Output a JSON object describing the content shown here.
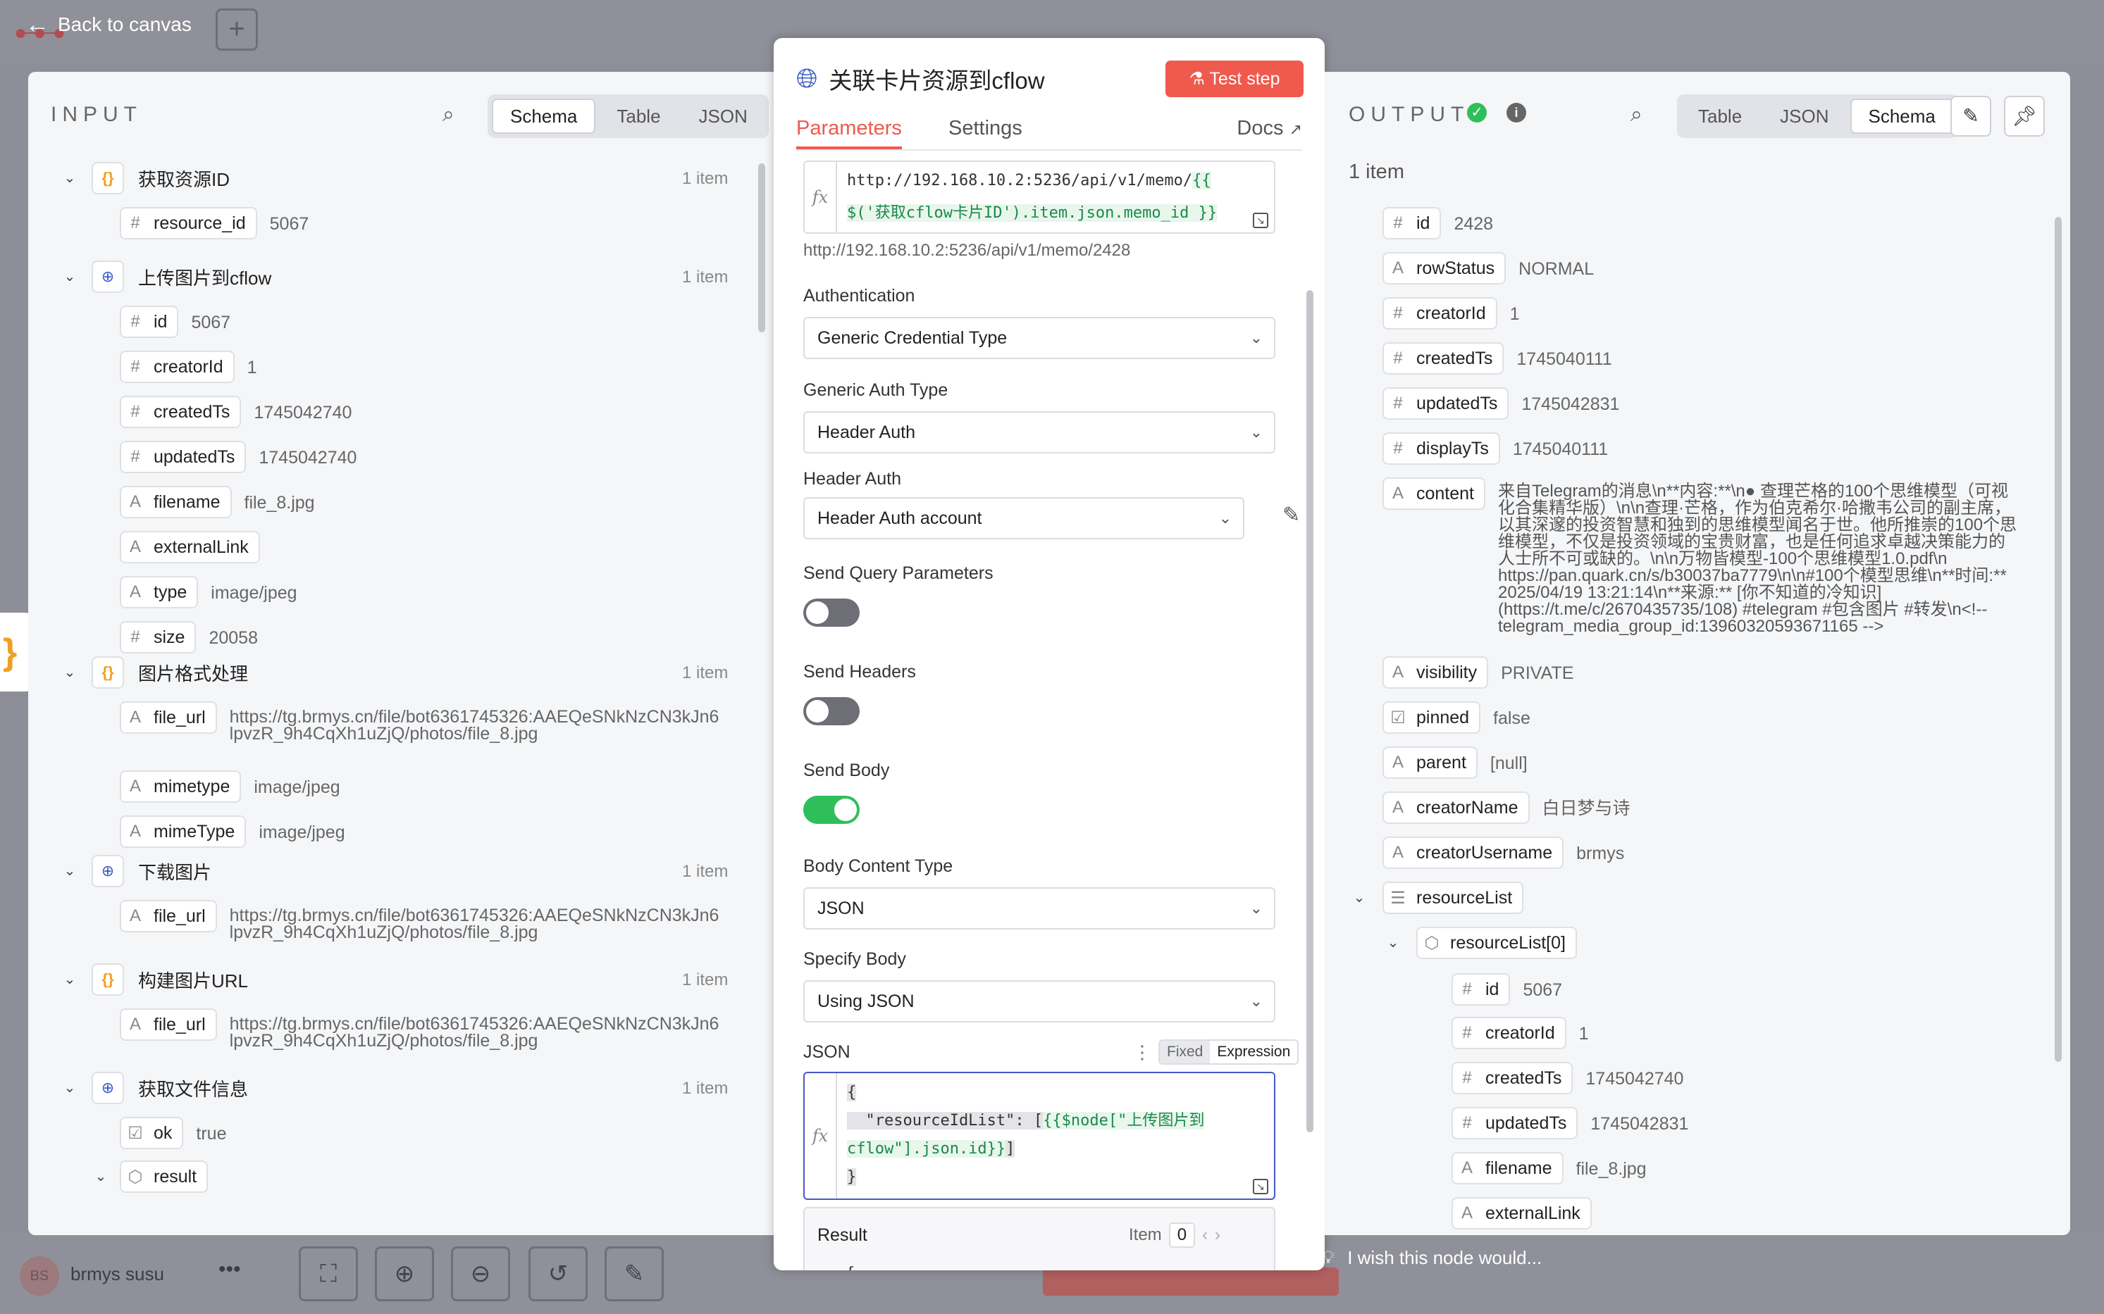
{
  "topbar": {
    "back_label": "Back to canvas",
    "plus_label": "+"
  },
  "bottombar": {
    "user_initials": "BS",
    "user_name": "brmys susu",
    "more_label": "•••",
    "idea_text": "I wish this node would..."
  },
  "input": {
    "title": "INPUT",
    "tabs": [
      "Schema",
      "Table",
      "JSON"
    ],
    "active_tab": "Schema",
    "nodes": [
      {
        "name": "获取资源ID",
        "icon": "brace",
        "count": "1 item",
        "fields": [
          {
            "type": "#",
            "key": "resource_id",
            "value": "5067"
          }
        ]
      },
      {
        "name": "上传图片到cflow",
        "icon": "globe",
        "count": "1 item",
        "fields": [
          {
            "type": "#",
            "key": "id",
            "value": "5067"
          },
          {
            "type": "#",
            "key": "creatorId",
            "value": "1"
          },
          {
            "type": "#",
            "key": "createdTs",
            "value": "1745042740"
          },
          {
            "type": "#",
            "key": "updatedTs",
            "value": "1745042740"
          },
          {
            "type": "A",
            "key": "filename",
            "value": "file_8.jpg"
          },
          {
            "type": "A",
            "key": "externalLink",
            "value": ""
          },
          {
            "type": "A",
            "key": "type",
            "value": "image/jpeg"
          },
          {
            "type": "#",
            "key": "size",
            "value": "20058"
          }
        ]
      },
      {
        "name": "图片格式处理",
        "icon": "brace",
        "count": "1 item",
        "fields": [
          {
            "type": "A",
            "key": "file_url",
            "value": "https://tg.brmys.cn/file/bot6361745326:AAEQeSNkNzCN3kJn6lpvzR_9h4CqXh1uZjQ/photos/file_8.jpg"
          },
          {
            "type": "A",
            "key": "mimetype",
            "value": "image/jpeg"
          },
          {
            "type": "A",
            "key": "mimeType",
            "value": "image/jpeg"
          }
        ]
      },
      {
        "name": "下载图片",
        "icon": "globe",
        "count": "1 item",
        "fields": [
          {
            "type": "A",
            "key": "file_url",
            "value": "https://tg.brmys.cn/file/bot6361745326:AAEQeSNkNzCN3kJn6lpvzR_9h4CqXh1uZjQ/photos/file_8.jpg"
          }
        ]
      },
      {
        "name": "构建图片URL",
        "icon": "brace",
        "count": "1 item",
        "fields": [
          {
            "type": "A",
            "key": "file_url",
            "value": "https://tg.brmys.cn/file/bot6361745326:AAEQeSNkNzCN3kJn6lpvzR_9h4CqXh1uZjQ/photos/file_8.jpg"
          }
        ]
      },
      {
        "name": "获取文件信息",
        "icon": "globe",
        "count": "1 item",
        "fields": [
          {
            "type": "☑",
            "key": "ok",
            "value": "true"
          },
          {
            "type": "⬡",
            "key": "result",
            "value": ""
          }
        ]
      }
    ]
  },
  "ndv": {
    "title": "关联卡片资源到cflow",
    "test_step_label": "Test step",
    "tabs": [
      "Parameters",
      "Settings"
    ],
    "docs_label": "Docs",
    "url_line1_plain": "http://192.168.10.2:5236/api/v1/memo/",
    "url_line1_expr": "{{",
    "url_line2_expr": "$('获取cflow卡片ID').item.json.memo_id }}",
    "url_preview": "http://192.168.10.2:5236/api/v1/memo/2428",
    "authentication_label": "Authentication",
    "authentication_value": "Generic Credential Type",
    "generic_auth_label": "Generic Auth Type",
    "generic_auth_value": "Header Auth",
    "header_auth_label": "Header Auth",
    "header_auth_value": "Header Auth account",
    "send_query_label": "Send Query Parameters",
    "send_query_on": false,
    "send_headers_label": "Send Headers",
    "send_headers_on": false,
    "send_body_label": "Send Body",
    "send_body_on": true,
    "body_content_label": "Body Content Type",
    "body_content_value": "JSON",
    "specify_body_label": "Specify Body",
    "specify_body_value": "Using JSON",
    "json_label": "JSON",
    "json_mode_fixed": "Fixed",
    "json_mode_expression": "Expression",
    "json_line1": "{",
    "json_line2_plain": "  \"resourceIdList\": [",
    "json_line2_expr": "{{$node[\"上传图片到",
    "json_line3_expr": "cflow\"].json.id}}",
    "json_line3_plain": "]",
    "json_line4": "}",
    "result_label": "Result",
    "result_item_label": "Item",
    "result_item_value": "0",
    "result_preview": "{"
  },
  "output": {
    "title": "OUTPUT",
    "tabs": [
      "Table",
      "JSON",
      "Schema"
    ],
    "active_tab": "Schema",
    "item_count": "1 item",
    "fields": [
      {
        "type": "#",
        "key": "id",
        "value": "2428"
      },
      {
        "type": "A",
        "key": "rowStatus",
        "value": "NORMAL"
      },
      {
        "type": "#",
        "key": "creatorId",
        "value": "1"
      },
      {
        "type": "#",
        "key": "createdTs",
        "value": "1745040111"
      },
      {
        "type": "#",
        "key": "updatedTs",
        "value": "1745042831"
      },
      {
        "type": "#",
        "key": "displayTs",
        "value": "1745040111"
      },
      {
        "type": "A",
        "key": "content",
        "value": "来自Telegram的消息\\n**内容:**\\n● 查理芒格的100个思维模型（可视化合集精华版）\\n\\n查理·芒格，作为伯克希尔·哈撒韦公司的副主席，以其深邃的投资智慧和独到的思维模型闻名于世。他所推崇的100个思维模型，不仅是投资领域的宝贵财富，也是任何追求卓越决策能力的人士所不可或缺的。\\n\\n万物皆模型-100个思维模型1.0.pdf\\n https://pan.quark.cn/s/b30037ba7779\\n\\n#100个模型思维\\n**时间:** 2025/04/19 13:21:14\\n**来源:** [你不知道的冷知识](https://t.me/c/2670435735/108) #telegram #包含图片 #转发\\n<!-- telegram_media_group_id:13960320593671165 -->"
      },
      {
        "type": "A",
        "key": "visibility",
        "value": "PRIVATE"
      },
      {
        "type": "☑",
        "key": "pinned",
        "value": "false"
      },
      {
        "type": "A",
        "key": "parent",
        "value": "[null]"
      },
      {
        "type": "A",
        "key": "creatorName",
        "value": "白日梦与诗"
      },
      {
        "type": "A",
        "key": "creatorUsername",
        "value": "brmys"
      },
      {
        "type": "☰",
        "key": "resourceList",
        "value": ""
      },
      {
        "type": "⬡",
        "key": "resourceList[0]",
        "value": ""
      },
      {
        "type": "#",
        "key": "id",
        "value": "5067"
      },
      {
        "type": "#",
        "key": "creatorId",
        "value": "1"
      },
      {
        "type": "#",
        "key": "createdTs",
        "value": "1745042740"
      },
      {
        "type": "#",
        "key": "updatedTs",
        "value": "1745042831"
      },
      {
        "type": "A",
        "key": "filename",
        "value": "file_8.jpg"
      },
      {
        "type": "A",
        "key": "externalLink",
        "value": ""
      }
    ]
  },
  "colors": {
    "accent": "#ef5a4c",
    "success": "#2fbf5a",
    "expression": "#1a8a4a",
    "focus": "#4a56c8"
  }
}
